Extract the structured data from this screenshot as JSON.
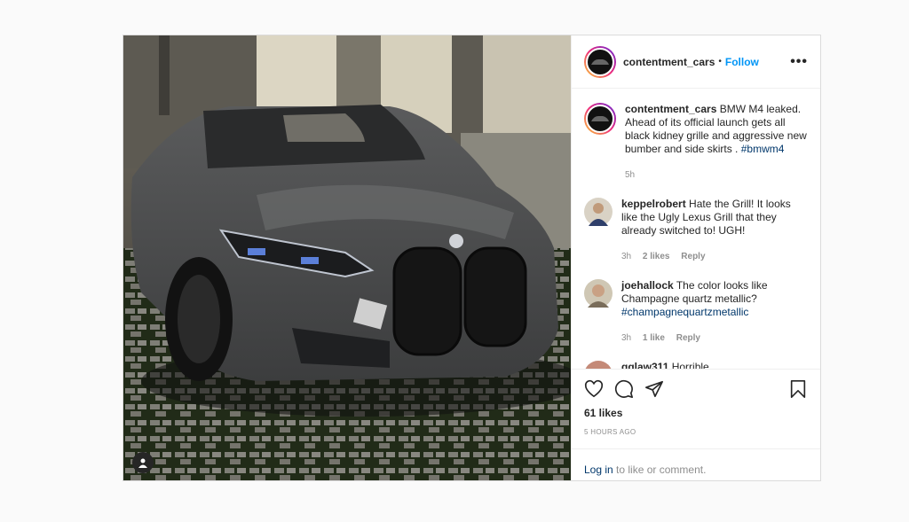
{
  "post": {
    "username": "contentment_cars",
    "dot": "•",
    "follow_label": "Follow",
    "more_label": "•••",
    "caption": {
      "username": "contentment_cars",
      "text": "BMW M4 leaked. Ahead of its official launch gets all black kidney grille and aggressive new bumber and side skirts . ",
      "hashtag": "#bmwm4",
      "time": "5h"
    },
    "comments": [
      {
        "username": "keppelrobert",
        "text": "Hate the Grill! It looks like the Ugly Lexus Grill that they already switched to! UGH!",
        "hashtag": "",
        "time": "3h",
        "likes": "2 likes",
        "reply": "Reply"
      },
      {
        "username": "joehallock",
        "text": "The color looks like Champagne quartz metallic? ",
        "hashtag": "#champagnequartzmetallic",
        "time": "3h",
        "likes": "1 like",
        "reply": "Reply"
      },
      {
        "username": "gglaw311",
        "text": "Horrible",
        "hashtag": ""
      }
    ],
    "likes_count": "61 likes",
    "posted_ago": "5 HOURS AGO",
    "login_link": "Log in",
    "login_rest": " to like or comment.",
    "icons": [
      "heart-icon",
      "comment-icon",
      "share-icon",
      "bookmark-icon",
      "user-tag-icon"
    ]
  },
  "colors": {
    "link": "#0095f6",
    "hashtag": "#00376b",
    "muted": "#8e8e8e"
  }
}
